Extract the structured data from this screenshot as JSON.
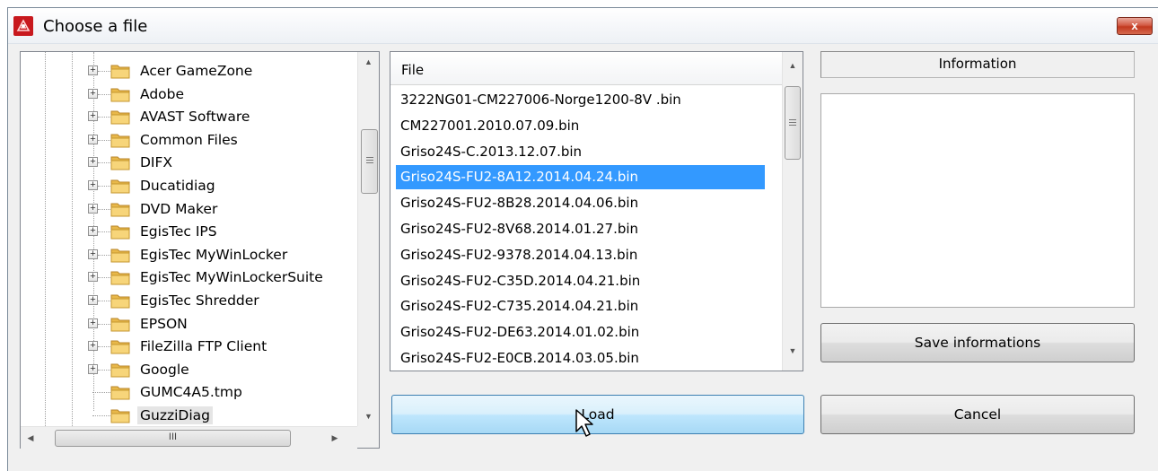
{
  "window": {
    "title": "Choose a file",
    "close_label": "x"
  },
  "tree": {
    "items": [
      {
        "label": "Acer GameZone",
        "expandable": true
      },
      {
        "label": "Adobe",
        "expandable": true
      },
      {
        "label": "AVAST Software",
        "expandable": true
      },
      {
        "label": "Common Files",
        "expandable": true
      },
      {
        "label": "DIFX",
        "expandable": true
      },
      {
        "label": "Ducatidiag",
        "expandable": true
      },
      {
        "label": "DVD Maker",
        "expandable": true
      },
      {
        "label": "EgisTec IPS",
        "expandable": true
      },
      {
        "label": "EgisTec MyWinLocker",
        "expandable": true
      },
      {
        "label": "EgisTec MyWinLockerSuite",
        "expandable": true
      },
      {
        "label": "EgisTec Shredder",
        "expandable": true
      },
      {
        "label": "EPSON",
        "expandable": true
      },
      {
        "label": "FileZilla FTP Client",
        "expandable": true
      },
      {
        "label": "Google",
        "expandable": true
      },
      {
        "label": "GUMC4A5.tmp",
        "expandable": false
      },
      {
        "label": "GuzziDiag",
        "expandable": false,
        "selected": true
      }
    ],
    "expander_glyph": "+",
    "hscroll_grip": "III"
  },
  "filelist": {
    "header": "File",
    "files": [
      "3222NG01-CM227006-Norge1200-8V .bin",
      "CM227001.2010.07.09.bin",
      "Griso24S-C.2013.12.07.bin",
      "Griso24S-FU2-8A12.2014.04.24.bin",
      "Griso24S-FU2-8B28.2014.04.06.bin",
      "Griso24S-FU2-8V68.2014.01.27.bin",
      "Griso24S-FU2-9378.2014.04.13.bin",
      "Griso24S-FU2-C35D.2014.04.21.bin",
      "Griso24S-FU2-C735.2014.04.21.bin",
      "Griso24S-FU2-DE63.2014.01.02.bin",
      "Griso24S-FU2-E0CB.2014.03.05.bin"
    ],
    "selected_index": 3
  },
  "info": {
    "header": "Information"
  },
  "buttons": {
    "save_info": "Save informations",
    "load": "Load",
    "cancel": "Cancel"
  },
  "colors": {
    "selection": "#3399ff",
    "title_icon": "#c8191e",
    "close_button": "#c2381f"
  },
  "icons": {
    "folder": "folder-icon",
    "app": "app-icon",
    "cursor": "mouse-cursor-icon"
  }
}
